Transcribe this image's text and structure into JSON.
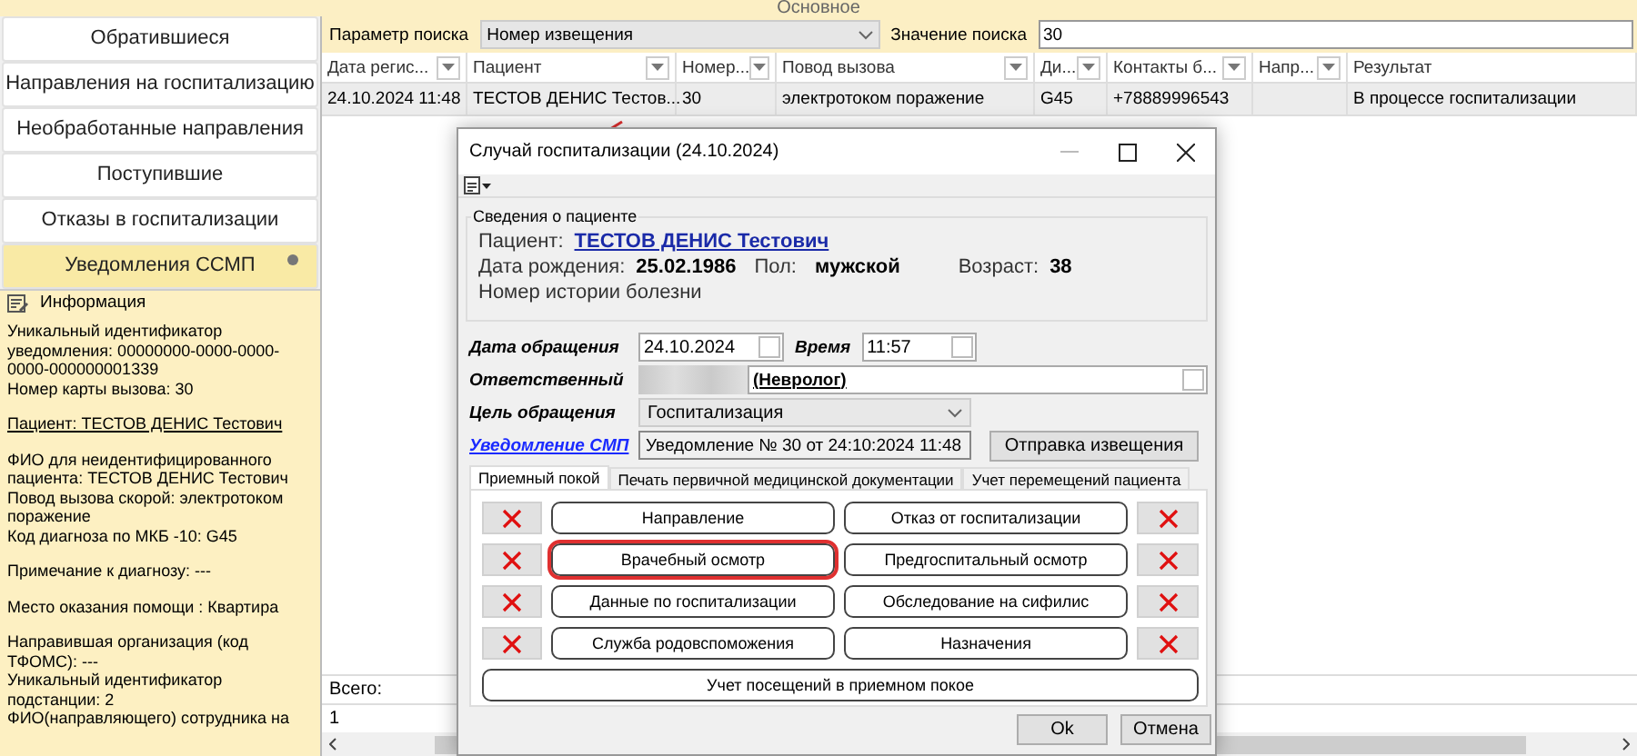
{
  "top_bar": {
    "title": "Основное"
  },
  "sidebar": {
    "items": [
      {
        "label": "Обратившиеся",
        "selected": false,
        "has_dot": false
      },
      {
        "label": "Направления на госпитализацию",
        "selected": false,
        "has_dot": false
      },
      {
        "label": "Необработанные направления",
        "selected": false,
        "has_dot": false
      },
      {
        "label": "Поступившие",
        "selected": false,
        "has_dot": false
      },
      {
        "label": "Отказы в госпитализации",
        "selected": false,
        "has_dot": false
      },
      {
        "label": "Уведомления ССМП",
        "selected": true,
        "has_dot": true
      }
    ]
  },
  "info": {
    "title": "Информация",
    "blocks": [
      {
        "underlined": false,
        "lines": [
          "Уникальный идентификатор уведомления: 00000000-0000-0000-0000-000000001339",
          "Номер карты вызова: 30"
        ]
      },
      {
        "underlined": true,
        "lines": [
          "Пациент: ТЕСТОВ ДЕНИС Тестович"
        ]
      },
      {
        "underlined": false,
        "lines": [
          "ФИО для неидентифицированного пациента: ТЕСТОВ ДЕНИС Тестович",
          "Повод вызова скорой: электротоком поражение",
          "Код диагноза по МКБ -10: G45"
        ]
      },
      {
        "underlined": false,
        "lines": [
          "Примечание к диагнозу: ---"
        ]
      },
      {
        "underlined": false,
        "lines": [
          "Место оказания помощи : Квартира"
        ]
      },
      {
        "underlined": false,
        "lines": [
          "Направившая организация (код ТФОМС): ---",
          "Уникальный идентификатор подстанции: 2",
          "ФИО(направляющего) сотрудника на"
        ]
      }
    ]
  },
  "search": {
    "param_label": "Параметр поиска",
    "param_value": "Номер извещения",
    "value_label": "Значение поиска",
    "value": "30"
  },
  "table": {
    "columns": [
      {
        "label": "Дата регис...",
        "filter": true
      },
      {
        "label": "Пациент",
        "filter": true
      },
      {
        "label": "Номер...",
        "filter": true
      },
      {
        "label": "Повод вызова",
        "filter": true
      },
      {
        "label": "Ди...",
        "filter": true
      },
      {
        "label": "Контакты б...",
        "filter": true
      },
      {
        "label": "Напр...",
        "filter": true
      },
      {
        "label": "Результат",
        "filter": false
      }
    ],
    "rows": [
      {
        "selected": true,
        "cells": [
          "24.10.2024 11:48",
          "ТЕСТОВ ДЕНИС Тестов...",
          "30",
          "электротоком поражение",
          "G45",
          "+78889996543",
          null,
          "В процессе госпитализации"
        ]
      }
    ],
    "footer": {
      "label": "Всего:",
      "value": "1"
    }
  },
  "dialog": {
    "title": "Случай госпитализации (24.10.2024)",
    "patient": {
      "legend": "Сведения о пациенте",
      "name_label": "Пациент:",
      "name": "ТЕСТОВ ДЕНИС Тестович",
      "birth_label": "Дата рождения:",
      "birth": "25.02.1986",
      "sex_label": "Пол:",
      "sex": "мужской",
      "age_label": "Возраст:",
      "age": "38",
      "history_label": "Номер истории болезни"
    },
    "form": {
      "date_label": "Дата обращения",
      "date": "24.10.2024",
      "time_label": "Время",
      "time": "11:57",
      "responsible_label": "Ответственный",
      "responsible": "(Невролог)",
      "purpose_label": "Цель обращения",
      "purpose": "Госпитализация",
      "notice_link": "Уведомление СМП",
      "notice_value": "Уведомление № 30 от 24:10:2024 11:48",
      "notice_button": "Отправка извещения"
    },
    "tabs": [
      {
        "label": "Приемный покой",
        "selected": true
      },
      {
        "label": "Печать первичной медицинской документации",
        "selected": false
      },
      {
        "label": "Учет перемещений пациента",
        "selected": false
      }
    ],
    "actions": [
      {
        "label": "Направление",
        "highlighted": false
      },
      {
        "label": "Отказ от госпитализации",
        "highlighted": false
      },
      {
        "label": "Врачебный осмотр",
        "highlighted": true
      },
      {
        "label": "Предгоспитальный осмотр",
        "highlighted": false
      },
      {
        "label": "Данные по госпитализации",
        "highlighted": false
      },
      {
        "label": "Обследование на сифилис",
        "highlighted": false
      },
      {
        "label": "Служба родовспоможения",
        "highlighted": false
      },
      {
        "label": "Назначения",
        "highlighted": false
      }
    ],
    "wide_action": "Учет посещений в приемном покое",
    "buttons": [
      "Ok",
      "Отмена"
    ]
  }
}
